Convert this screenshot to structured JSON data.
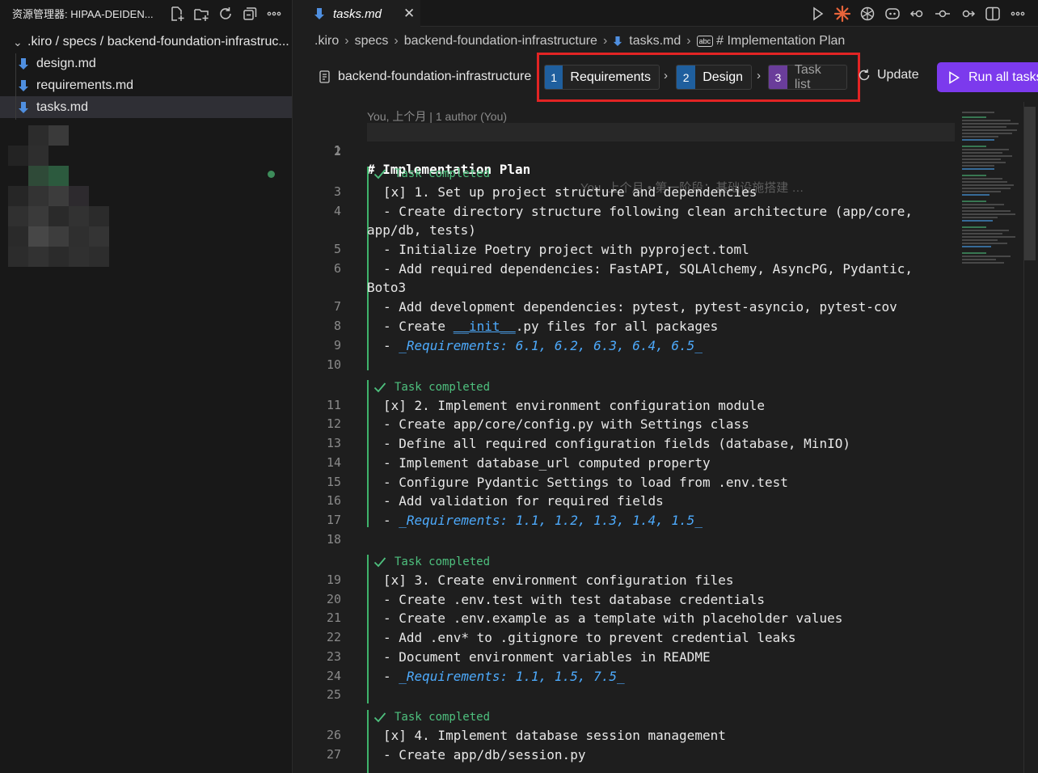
{
  "sidebar": {
    "title": "资源管理器: HIPAA-DEIDEN...",
    "root_folder": ".kiro / specs / backend-foundation-infrastruc...",
    "files": [
      {
        "name": "design.md",
        "active": false
      },
      {
        "name": "requirements.md",
        "active": false
      },
      {
        "name": "tasks.md",
        "active": true
      }
    ]
  },
  "tab": {
    "label": "tasks.md",
    "close": "✕"
  },
  "breadcrumb": {
    "parts": [
      ".kiro",
      "specs",
      "backend-foundation-infrastructure",
      "tasks.md"
    ],
    "symbol_badge": "abc",
    "symbol": "# Implementation Plan"
  },
  "spec": {
    "name": "backend-foundation-infrastructure",
    "stages": [
      {
        "num": "1",
        "label": "Requirements",
        "color": "#1f5f9e"
      },
      {
        "num": "2",
        "label": "Design",
        "color": "#1f5f9e"
      },
      {
        "num": "3",
        "label": "Task list",
        "color": "#6a3d9a"
      }
    ],
    "update_label": "Update",
    "run_label": "Run all tasks"
  },
  "editor": {
    "blame_header": "You, 上个月 | 1 author (You)",
    "blame_inline": "You, 上个月 • 第一阶段：基础设施搭建 …",
    "lens_label": "Task completed",
    "lines": {
      "l1": "# Implementation Plan",
      "l3": "[x] 1. Set up project structure and dependencies",
      "l4a": "- Create directory structure following clean architecture (app/core,",
      "l4b": "app/db, tests)",
      "l5": "- Initialize Poetry project with pyproject.toml",
      "l6a": "- Add required dependencies: FastAPI, SQLAlchemy, AsyncPG, Pydantic,",
      "l6b": "Boto3",
      "l7": "- Add development dependencies: pytest, pytest-asyncio, pytest-cov",
      "l8a": "- Create ",
      "l8b": "__init__",
      "l8c": ".py files for all packages",
      "l9": "_Requirements: 6.1, 6.2, 6.3, 6.4, 6.5_",
      "l11": "[x] 2. Implement environment configuration module",
      "l12": "- Create app/core/config.py with Settings class",
      "l13": "- Define all required configuration fields (database, MinIO)",
      "l14": "- Implement database_url computed property",
      "l15": "- Configure Pydantic Settings to load from .env.test",
      "l16": "- Add validation for required fields",
      "l17": "_Requirements: 1.1, 1.2, 1.3, 1.4, 1.5_",
      "l19": "[x] 3. Create environment configuration files",
      "l20": "- Create .env.test with test database credentials",
      "l21": "- Create .env.example as a template with placeholder values",
      "l22": "- Add .env* to .gitignore to prevent credential leaks",
      "l23": "- Document environment variables in README",
      "l24": "_Requirements: 1.1, 1.5, 7.5_",
      "l26": "[x] 4. Implement database session management",
      "l27": "- Create app/db/session.py"
    },
    "dash": "- "
  },
  "colors": {
    "accent": "#7c3aed",
    "highlight_box": "#e22424",
    "task_green": "#4ec07e",
    "link_blue": "#4daafc"
  }
}
